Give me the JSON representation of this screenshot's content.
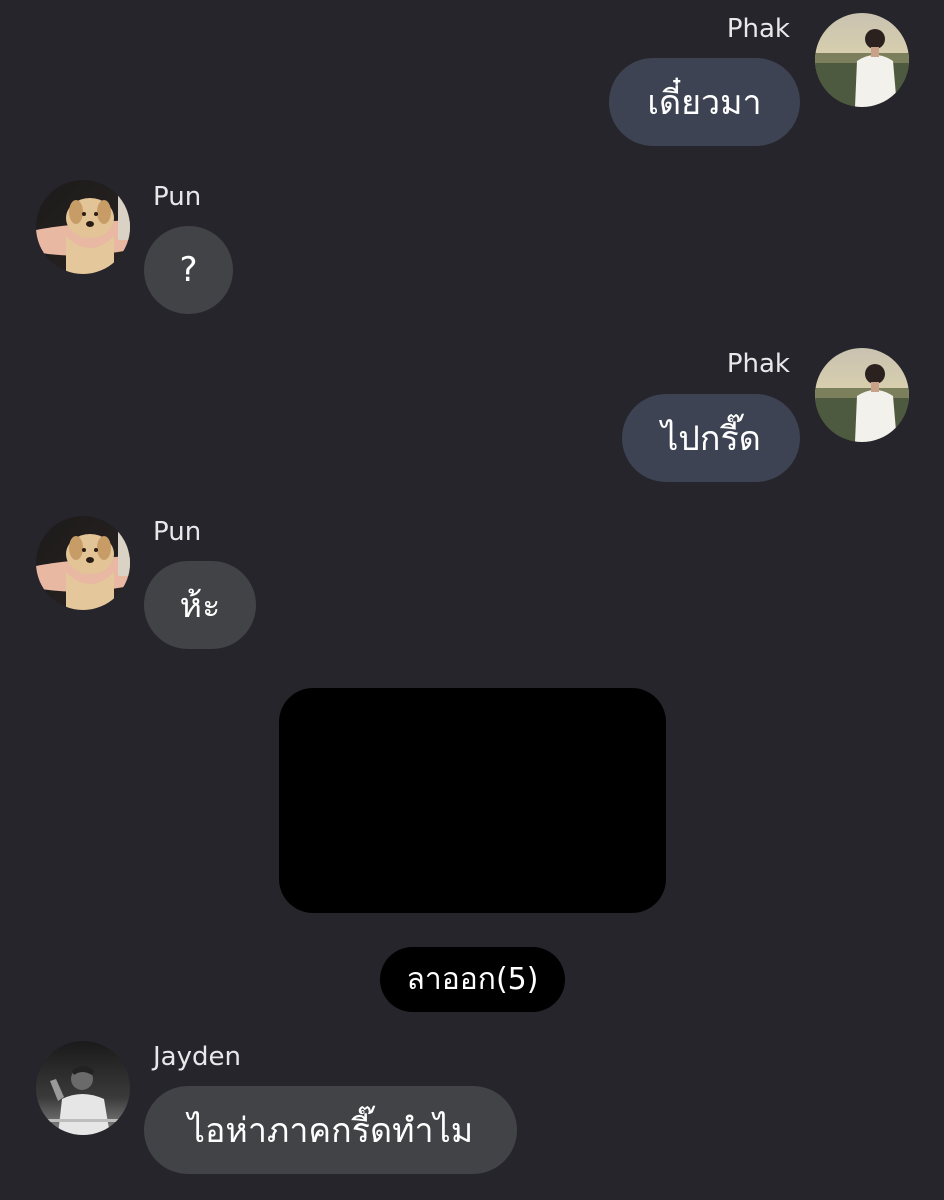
{
  "messages": [
    {
      "sender": "Phak",
      "text": "เดี๋ยวมา",
      "side": "right"
    },
    {
      "sender": "Pun",
      "text": "?",
      "side": "left"
    },
    {
      "sender": "Phak",
      "text": "ไปกรี๊ด",
      "side": "right"
    },
    {
      "sender": "Pun",
      "text": "ห้ะ",
      "side": "left"
    },
    {
      "sender": "Jayden",
      "text": "ไอห่าภาคกรี๊ดทำไม",
      "side": "left"
    }
  ],
  "system_notice": "ลาออก(5)",
  "colors": {
    "background": "#25252b",
    "mine_bubble": "#3d4352",
    "theirs_bubble": "#424347",
    "notice_pill": "#000000",
    "media_placeholder": "#000000"
  },
  "icons": {
    "phak_avatar": "person-photo-avatar",
    "pun_avatar": "puppy-photo-avatar",
    "jayden_avatar": "person-bw-photo-avatar"
  }
}
